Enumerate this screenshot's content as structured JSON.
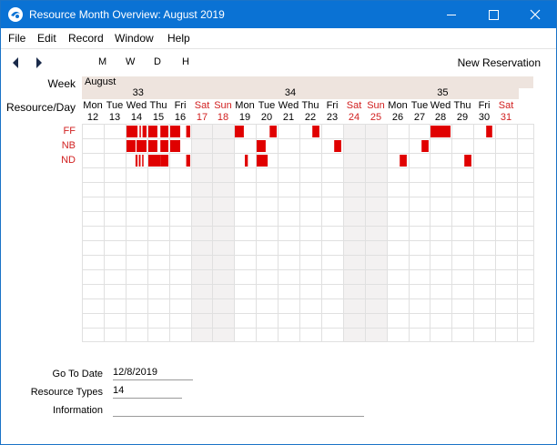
{
  "window": {
    "title": "Resource Month Overview: August 2019"
  },
  "menu": [
    "File",
    "Edit",
    "Record",
    "Window",
    "Help"
  ],
  "toolbar": {
    "views": [
      "M",
      "W",
      "D",
      "H"
    ],
    "new_reservation": "New Reservation"
  },
  "labels": {
    "week": "Week",
    "resource_day": "Resource/Day"
  },
  "month": "August",
  "weeks": [
    "33",
    "34",
    "35"
  ],
  "days": [
    {
      "dow": "Mon",
      "num": "12",
      "weekend": false
    },
    {
      "dow": "Tue",
      "num": "13",
      "weekend": false
    },
    {
      "dow": "Wed",
      "num": "14",
      "weekend": false
    },
    {
      "dow": "Thu",
      "num": "15",
      "weekend": false
    },
    {
      "dow": "Fri",
      "num": "16",
      "weekend": false
    },
    {
      "dow": "Sat",
      "num": "17",
      "weekend": true
    },
    {
      "dow": "Sun",
      "num": "18",
      "weekend": true
    },
    {
      "dow": "Mon",
      "num": "19",
      "weekend": false
    },
    {
      "dow": "Tue",
      "num": "20",
      "weekend": false
    },
    {
      "dow": "Wed",
      "num": "21",
      "weekend": false
    },
    {
      "dow": "Thu",
      "num": "22",
      "weekend": false
    },
    {
      "dow": "Fri",
      "num": "23",
      "weekend": false
    },
    {
      "dow": "Sat",
      "num": "24",
      "weekend": true
    },
    {
      "dow": "Sun",
      "num": "25",
      "weekend": true
    },
    {
      "dow": "Mon",
      "num": "26",
      "weekend": false
    },
    {
      "dow": "Tue",
      "num": "27",
      "weekend": false
    },
    {
      "dow": "Wed",
      "num": "28",
      "weekend": false
    },
    {
      "dow": "Thu",
      "num": "29",
      "weekend": false
    },
    {
      "dow": "Fri",
      "num": "30",
      "weekend": false
    },
    {
      "dow": "Sat",
      "num": "31",
      "weekend": true
    }
  ],
  "resources": [
    "FF",
    "NB",
    "ND"
  ],
  "reservations": [
    {
      "resource": "FF",
      "day": "14",
      "from": 0.0,
      "to": 0.55
    },
    {
      "resource": "FF",
      "day": "14",
      "from": 0.65,
      "to": 0.72
    },
    {
      "resource": "FF",
      "day": "14",
      "from": 0.8,
      "to": 1.0
    },
    {
      "resource": "FF",
      "day": "15",
      "from": 0.0,
      "to": 0.45
    },
    {
      "resource": "FF",
      "day": "15",
      "from": 0.6,
      "to": 1.0
    },
    {
      "resource": "FF",
      "day": "16",
      "from": 0.0,
      "to": 0.5
    },
    {
      "resource": "FF",
      "day": "16",
      "from": 0.8,
      "to": 1.0
    },
    {
      "resource": "FF",
      "day": "19",
      "from": 0.0,
      "to": 0.45
    },
    {
      "resource": "FF",
      "day": "20",
      "from": 0.65,
      "to": 1.0
    },
    {
      "resource": "FF",
      "day": "22",
      "from": 0.6,
      "to": 0.95
    },
    {
      "resource": "FF",
      "day": "28",
      "from": 0.0,
      "to": 1.0
    },
    {
      "resource": "FF",
      "day": "30",
      "from": 0.6,
      "to": 0.9
    },
    {
      "resource": "NB",
      "day": "14",
      "from": 0.0,
      "to": 0.45
    },
    {
      "resource": "NB",
      "day": "14",
      "from": 0.5,
      "to": 1.0
    },
    {
      "resource": "NB",
      "day": "15",
      "from": 0.0,
      "to": 0.45
    },
    {
      "resource": "NB",
      "day": "15",
      "from": 0.6,
      "to": 1.0
    },
    {
      "resource": "NB",
      "day": "16",
      "from": 0.0,
      "to": 0.5
    },
    {
      "resource": "NB",
      "day": "20",
      "from": 0.0,
      "to": 0.45
    },
    {
      "resource": "NB",
      "day": "23",
      "from": 0.6,
      "to": 0.95
    },
    {
      "resource": "NB",
      "day": "27",
      "from": 0.6,
      "to": 0.95
    },
    {
      "resource": "ND",
      "day": "14",
      "from": 0.45,
      "to": 0.55
    },
    {
      "resource": "ND",
      "day": "14",
      "from": 0.62,
      "to": 0.7
    },
    {
      "resource": "ND",
      "day": "14",
      "from": 0.78,
      "to": 0.85
    },
    {
      "resource": "ND",
      "day": "15",
      "from": 0.0,
      "to": 0.6
    },
    {
      "resource": "ND",
      "day": "15",
      "from": 0.6,
      "to": 1.0
    },
    {
      "resource": "ND",
      "day": "16",
      "from": 0.8,
      "to": 1.0
    },
    {
      "resource": "ND",
      "day": "19",
      "from": 0.5,
      "to": 0.65
    },
    {
      "resource": "ND",
      "day": "20",
      "from": 0.0,
      "to": 0.55
    },
    {
      "resource": "ND",
      "day": "26",
      "from": 0.6,
      "to": 0.95
    },
    {
      "resource": "ND",
      "day": "29",
      "from": 0.6,
      "to": 0.95
    }
  ],
  "form": {
    "go_to_date_label": "Go To Date",
    "go_to_date_value": "12/8/2019",
    "resource_types_label": "Resource Types",
    "resource_types_value": "14",
    "information_label": "Information",
    "information_value": ""
  },
  "colors": {
    "titlebar": "#0a72d4",
    "reservation": "#e00000",
    "weekend_text": "#d12020",
    "weekend_fill": "#f3f1f1",
    "header_band": "#eee4de",
    "grid_line": "#e0e0e0"
  }
}
